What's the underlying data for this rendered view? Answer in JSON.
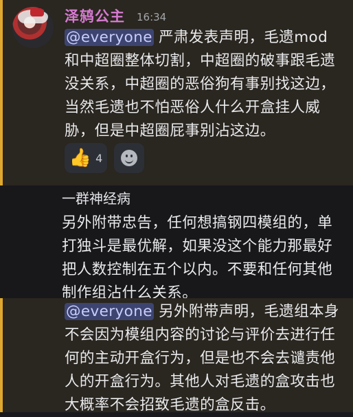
{
  "message1": {
    "username": "泽鸫公主",
    "timestamp": "16:34",
    "mention": "@everyone",
    "body": " 严肃发表声明，毛遗mod和中超圈整体切割，中超圈的破事跟毛遗没关系，中超圈的恶俗狗有事别找这边，当然毛遗也不怕恶俗人什么开盒挂人威胁，但是中超圈屁事别沾这边。",
    "reactions": [
      {
        "icon": "thumbs-up-icon",
        "emoji": "👍",
        "count": "4"
      }
    ],
    "add_reaction_icon": "add-reaction-icon"
  },
  "message2": {
    "subject": "一群神经病",
    "body": "另外附带忠告，任何想搞钢四模组的，单打独斗是最优解，如果没这个能力那最好把人数控制在五个以内。不要和任何其他制作组沾什么关系。"
  },
  "message3": {
    "mention": "@everyone",
    "body": " 另外附带声明，毛遗组本身不会因为模组内容的讨论与评价去进行任何的主动开盒行为，但是也不会去谴责他人的开盒行为。其他人对毛遗的盒攻击也大概率不会招致毛遗的盒反击。"
  },
  "colors": {
    "background": "#1a1a1e",
    "highlight": "#2a2620",
    "highlight_border": "#e0a82e",
    "username": "#d77bd2",
    "mention_bg": "#3d4470"
  }
}
